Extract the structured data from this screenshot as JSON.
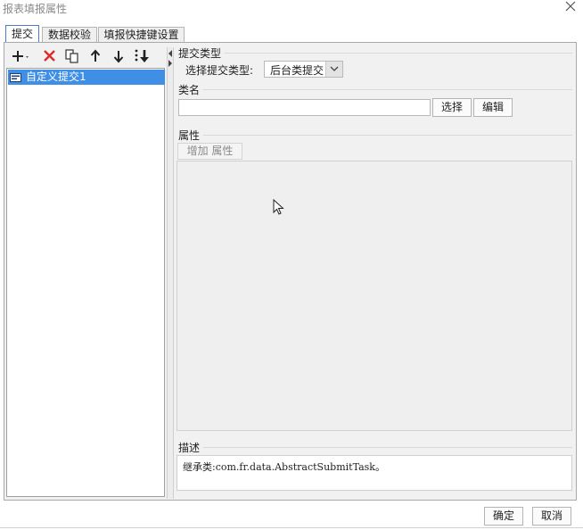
{
  "window": {
    "title": "报表填报属性"
  },
  "tabs": [
    {
      "label": "提交",
      "active": true
    },
    {
      "label": "数据校验",
      "active": false
    },
    {
      "label": "填报快捷键设置",
      "active": false
    }
  ],
  "toolbar": {
    "icons": [
      "add-icon",
      "delete-icon",
      "copy-icon",
      "move-up-icon",
      "move-down-icon",
      "move-bottom-icon"
    ]
  },
  "tree": {
    "items": [
      {
        "label": "自定义提交1",
        "selected": true
      }
    ]
  },
  "submit_type": {
    "group_label": "提交类型",
    "select_label": "选择提交类型:",
    "selected_value": "后台类提交"
  },
  "class_name": {
    "group_label": "类名",
    "value": "",
    "select_button": "选择",
    "edit_button": "编辑"
  },
  "properties": {
    "group_label": "属性",
    "add_button": "增加 属性"
  },
  "description": {
    "group_label": "描述",
    "text": "继承类:com.fr.data.AbstractSubmitTask。"
  },
  "footer": {
    "ok_button": "确定",
    "cancel_button": "取消"
  },
  "colors": {
    "selection": "#3f8fe6",
    "active_tab_border": "#4a7bd0",
    "delete_icon": "#e02a2a"
  }
}
